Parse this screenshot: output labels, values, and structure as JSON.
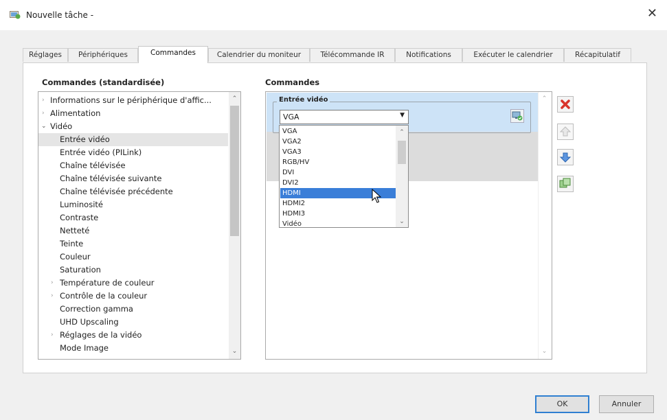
{
  "window": {
    "title": "Nouvelle tâche -"
  },
  "tabs": [
    "Réglages",
    "Périphériques",
    "Commandes",
    "Calendrier du moniteur",
    "Télécommande IR",
    "Notifications",
    "Exécuter le calendrier",
    "Récapitulatif"
  ],
  "active_tab": "Commandes",
  "left_panel": {
    "title": "Commandes (standardisée)",
    "items": [
      "Informations sur le périphérique d'affic...",
      "Alimentation",
      "Vidéo",
      "Entrée vidéo",
      "Entrée vidéo (PILink)",
      "Chaîne télévisée",
      "Chaîne télévisée suivante",
      "Chaîne télévisée précédente",
      "Luminosité",
      "Contraste",
      "Netteté",
      "Teinte",
      "Couleur",
      "Saturation",
      "Température de couleur",
      "Contrôle de la couleur",
      "Correction gamma",
      "UHD Upscaling",
      "Réglages de la vidéo",
      "Mode Image"
    ],
    "selected": "Entrée vidéo"
  },
  "right_panel": {
    "title": "Commandes",
    "command_group": "Entrée vidéo",
    "combo_value": "VGA",
    "dropdown_options": [
      "VGA",
      "VGA2",
      "VGA3",
      "RGB/HV",
      "DVI",
      "DVI2",
      "HDMI",
      "HDMI2",
      "HDMI3",
      "Vidéo"
    ],
    "hovered_option": "HDMI"
  },
  "footer": {
    "ok": "OK",
    "cancel": "Annuler"
  }
}
